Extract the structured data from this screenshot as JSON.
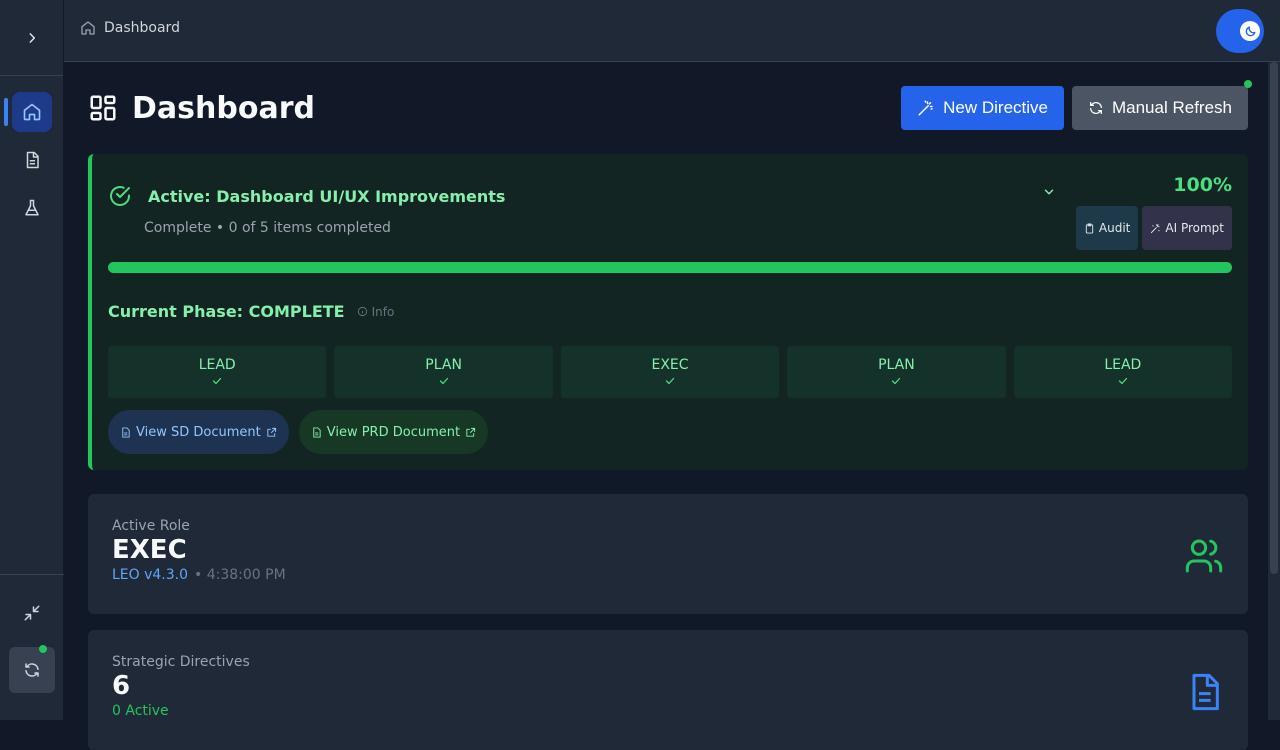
{
  "header": {
    "breadcrumb": "Dashboard"
  },
  "sidebar": {
    "items": [
      {
        "name": "home-icon",
        "active": true
      },
      {
        "name": "document-icon",
        "active": false
      },
      {
        "name": "flask-icon",
        "active": false
      }
    ]
  },
  "page": {
    "title": "Dashboard",
    "new_directive_label": "New Directive",
    "manual_refresh_label": "Manual Refresh"
  },
  "directive": {
    "title": "Active: Dashboard UI/UX Improvements",
    "subtitle": "Complete • 0 of 5 items completed",
    "percent": "100%",
    "progress": 1.0,
    "audit_label": "Audit",
    "ai_prompt_label": "AI Prompt",
    "phase_title": "Current Phase: COMPLETE",
    "info_label": "Info",
    "steps": [
      "LEAD",
      "PLAN",
      "EXEC",
      "PLAN",
      "LEAD"
    ],
    "view_sd_label": "View SD Document",
    "view_prd_label": "View PRD Document"
  },
  "active_role": {
    "label": "Active Role",
    "value": "EXEC",
    "version": "LEO v4.3.0",
    "time": "• 4:38:00 PM"
  },
  "strategic_directives": {
    "label": "Strategic Directives",
    "value": "6",
    "active": "0 Active"
  },
  "colors": {
    "accent": "#2563eb",
    "success": "#22c55e",
    "background": "#111827",
    "panel": "#1f2937"
  }
}
